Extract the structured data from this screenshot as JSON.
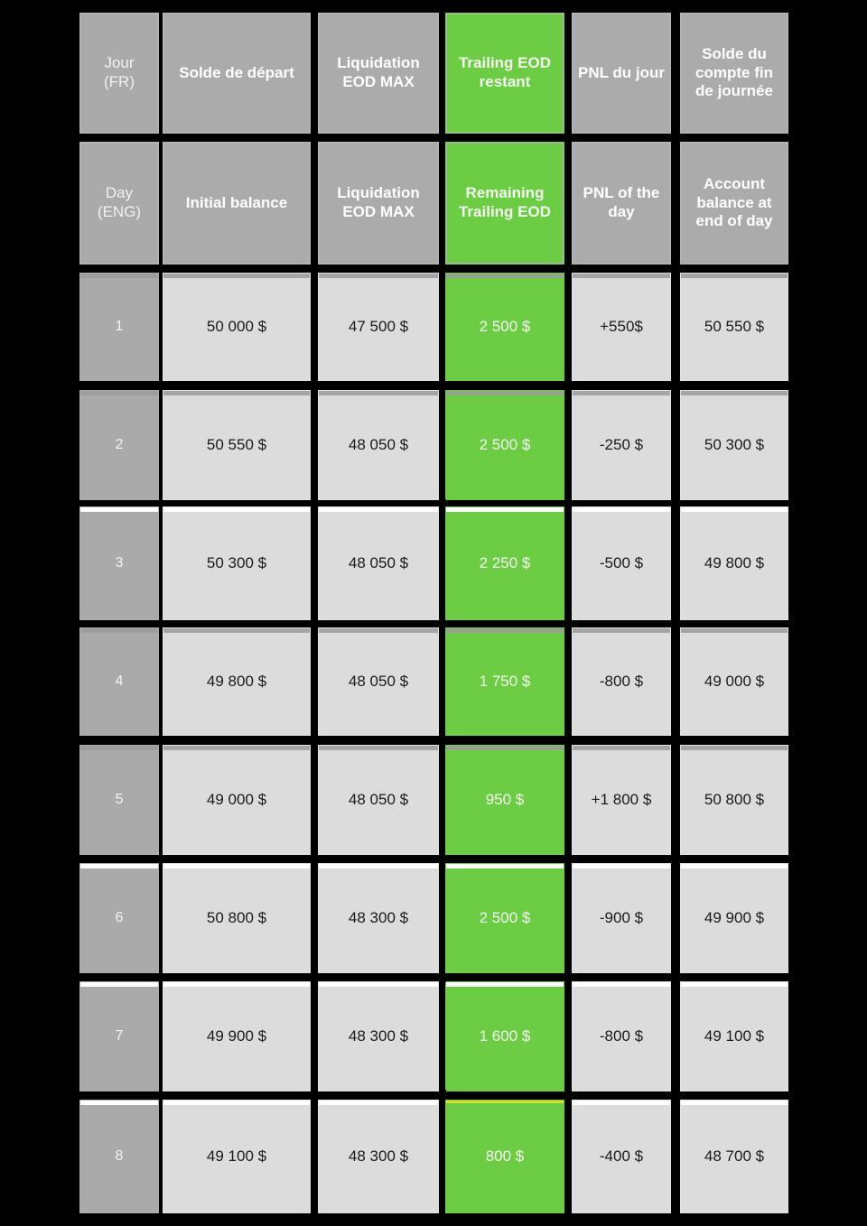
{
  "table": {
    "header_fr": {
      "day": "Jour\n(FR)",
      "day_line1": "Jour",
      "day_line2": "(FR)",
      "initial_balance": "Solde de départ",
      "liquidation": "Liquidation EOD MAX",
      "trailing": "Trailing EOD restant",
      "pnl": "PNL du jour",
      "end_balance": "Solde du compte fin de journée"
    },
    "header_eng": {
      "day_line1": "Day",
      "day_line2": "(ENG)",
      "initial_balance": "Initial balance",
      "liquidation": "Liquidation EOD MAX",
      "trailing": "Remaining Trailing EOD",
      "pnl": "PNL of the day",
      "end_balance": "Account balance at end of day"
    },
    "columns": [
      "Jour (FR) / Day (ENG)",
      "Solde de départ / Initial balance",
      "Liquidation EOD MAX",
      "Trailing EOD restant / Remaining Trailing EOD",
      "PNL du jour / PNL of the day",
      "Solde du compte fin de journée / Account balance at end of day"
    ],
    "rows": [
      {
        "day": "1",
        "initial_balance": "50 000 $",
        "liquidation": "47 500 $",
        "trailing": "2 500 $",
        "pnl": "+550$",
        "end_balance": "50 550 $"
      },
      {
        "day": "2",
        "initial_balance": "50 550 $",
        "liquidation": "48 050 $",
        "trailing": "2 500 $",
        "pnl": "-250 $",
        "end_balance": "50 300 $"
      },
      {
        "day": "3",
        "initial_balance": "50 300 $",
        "liquidation": "48 050 $",
        "trailing": "2 250 $",
        "pnl": "-500 $",
        "end_balance": "49 800 $"
      },
      {
        "day": "4",
        "initial_balance": "49 800 $",
        "liquidation": "48 050 $",
        "trailing": "1 750 $",
        "pnl": "-800 $",
        "end_balance": "49 000 $"
      },
      {
        "day": "5",
        "initial_balance": "49 000 $",
        "liquidation": "48 050 $",
        "trailing": "950 $",
        "pnl": "+1 800 $",
        "end_balance": "50 800 $"
      },
      {
        "day": "6",
        "initial_balance": "50 800 $",
        "liquidation": "48 300 $",
        "trailing": "2 500 $",
        "pnl": "-900 $",
        "end_balance": "49 900 $"
      },
      {
        "day": "7",
        "initial_balance": "49 900 $",
        "liquidation": "48 300 $",
        "trailing": "1 600 $",
        "pnl": "-800 $",
        "end_balance": "49 100 $"
      },
      {
        "day": "8",
        "initial_balance": "49 100 $",
        "liquidation": "48 300 $",
        "trailing": "800 $",
        "pnl": "-400 $",
        "end_balance": "48 700 $"
      }
    ]
  },
  "colors": {
    "background": "#000000",
    "header_gray": "#ababab",
    "cell_gray": "#dcdcdc",
    "day_gray": "#aaaaaa",
    "highlight_green": "#6ccd44",
    "accent_yellow": "#ece22e",
    "text_dark": "#1a1a1a",
    "text_light": "#ffffff"
  }
}
